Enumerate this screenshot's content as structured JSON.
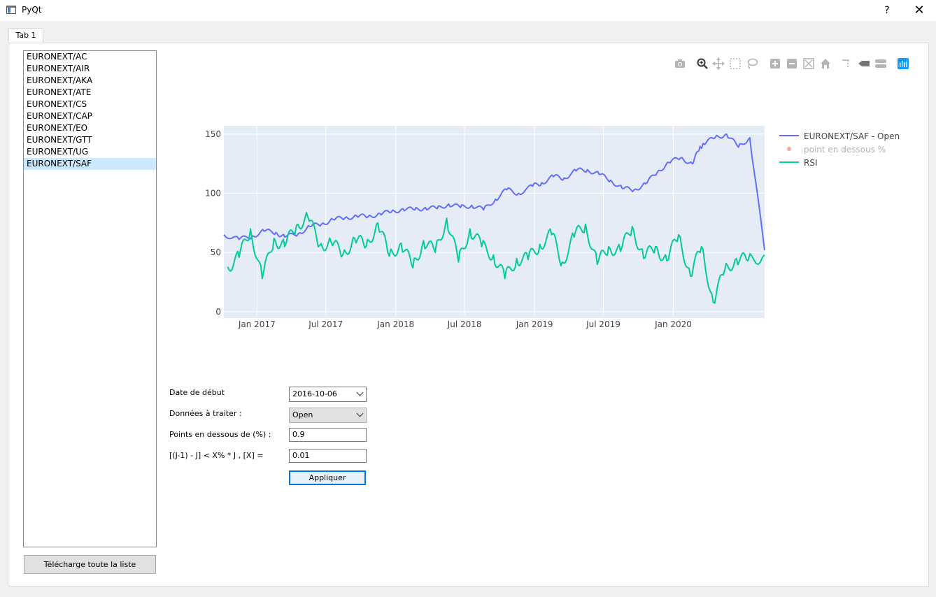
{
  "window": {
    "title": "PyQt",
    "help": "?",
    "close": "✕"
  },
  "tabs": [
    {
      "label": "Tab 1"
    }
  ],
  "sidebar": {
    "items": [
      {
        "label": "EURONEXT/AC"
      },
      {
        "label": "EURONEXT/AIR"
      },
      {
        "label": "EURONEXT/AKA"
      },
      {
        "label": "EURONEXT/ATE"
      },
      {
        "label": "EURONEXT/CS"
      },
      {
        "label": "EURONEXT/CAP"
      },
      {
        "label": "EURONEXT/EO"
      },
      {
        "label": "EURONEXT/GTT"
      },
      {
        "label": "EURONEXT/UG"
      },
      {
        "label": "EURONEXT/SAF"
      }
    ],
    "selected": "EURONEXT/SAF",
    "download_button": "Télécharge toute la liste"
  },
  "modebar": {
    "icons": [
      "camera-icon",
      "zoom-icon",
      "pan-icon",
      "box-select-icon",
      "lasso-icon",
      "zoom-in-icon",
      "zoom-out-icon",
      "autoscale-icon",
      "reset-axes-icon",
      "spike-lines-icon",
      "hover-closest-icon",
      "hover-compare-icon",
      "plotly-logo-icon"
    ]
  },
  "form": {
    "start_date": {
      "label": "Date de début",
      "value": "2016-10-06"
    },
    "data_type": {
      "label": "Données à traiter :",
      "value": "Open"
    },
    "points_below": {
      "label": "Points en dessous de (%) :",
      "value": "0.9"
    },
    "formula": {
      "label": "[(J-1) - J] < X% * J  , [X] =",
      "value": "0.01"
    },
    "apply_button": "Appliquer"
  },
  "colors": {
    "open": "#636efa",
    "points": "#ef553b",
    "rsi": "#00cc96",
    "plot_bg": "#e5ecf6",
    "selection": "#cce8ff",
    "accent": "#0078d7"
  },
  "chart_data": {
    "type": "line",
    "xlabel": "",
    "ylabel": "",
    "x_ticks": [
      "Jan 2017",
      "Jul 2017",
      "Jan 2018",
      "Jul 2018",
      "Jan 2019",
      "Jul 2019",
      "Jan 2020"
    ],
    "y_ticks": [
      0,
      50,
      100,
      150
    ],
    "ylim": [
      -3,
      157
    ],
    "xlim": [
      "2016-10-06",
      "2020-08-28"
    ],
    "grid": true,
    "legend_position": "right",
    "series": [
      {
        "name": "EURONEXT/SAF - Open",
        "type": "line",
        "x": [
          "2016-10-06",
          "2016-11-15",
          "2016-12-20",
          "2017-01-20",
          "2017-02-20",
          "2017-03-15",
          "2017-04-20",
          "2017-05-20",
          "2017-06-20",
          "2017-07-20",
          "2017-08-20",
          "2017-09-20",
          "2017-10-20",
          "2017-11-20",
          "2017-12-20",
          "2018-01-20",
          "2018-02-20",
          "2018-03-20",
          "2018-04-20",
          "2018-05-20",
          "2018-06-20",
          "2018-07-20",
          "2018-08-20",
          "2018-09-20",
          "2018-10-20",
          "2018-11-20",
          "2018-12-27",
          "2019-01-20",
          "2019-02-20",
          "2019-03-20",
          "2019-04-20",
          "2019-05-20",
          "2019-06-20",
          "2019-07-20",
          "2019-08-20",
          "2019-09-20",
          "2019-10-20",
          "2019-11-20",
          "2019-12-20",
          "2020-01-20",
          "2020-02-20",
          "2020-03-10",
          "2020-03-20",
          "2020-04-20",
          "2020-05-20",
          "2020-06-20",
          "2020-07-20",
          "2020-08-28"
        ],
        "y": [
          65,
          61,
          64,
          68,
          67,
          63,
          66,
          72,
          74,
          78,
          79,
          81,
          80,
          83,
          84,
          87,
          86,
          88,
          87,
          91,
          88,
          90,
          86,
          95,
          103,
          100,
          106,
          109,
          114,
          113,
          119,
          120,
          116,
          111,
          104,
          103,
          108,
          118,
          126,
          130,
          125,
          138,
          142,
          147,
          150,
          139,
          147,
          52
        ]
      },
      {
        "name": "point en dessous %",
        "type": "scatter",
        "x": [],
        "y": []
      },
      {
        "name": "RSI",
        "type": "line",
        "x": [
          "2016-10-16",
          "2016-11-15",
          "2016-12-15",
          "2017-01-15",
          "2017-02-15",
          "2017-03-15",
          "2017-04-15",
          "2017-05-15",
          "2017-06-15",
          "2017-07-15",
          "2017-08-15",
          "2017-09-15",
          "2017-10-15",
          "2017-11-15",
          "2017-12-15",
          "2018-01-15",
          "2018-02-15",
          "2018-03-15",
          "2018-04-15",
          "2018-05-15",
          "2018-06-15",
          "2018-07-15",
          "2018-08-15",
          "2018-09-15",
          "2018-10-15",
          "2018-11-15",
          "2018-12-15",
          "2019-01-15",
          "2019-02-15",
          "2019-03-15",
          "2019-04-15",
          "2019-05-15",
          "2019-06-15",
          "2019-07-15",
          "2019-08-15",
          "2019-09-15",
          "2019-10-15",
          "2019-11-15",
          "2019-12-15",
          "2020-01-15",
          "2020-02-15",
          "2020-03-15",
          "2020-04-15",
          "2020-05-15",
          "2020-06-15",
          "2020-07-15",
          "2020-08-28"
        ],
        "y": [
          38,
          46,
          70,
          28,
          62,
          55,
          73,
          80,
          56,
          59,
          48,
          62,
          55,
          75,
          47,
          58,
          37,
          60,
          50,
          79,
          42,
          70,
          55,
          48,
          28,
          45,
          44,
          57,
          65,
          42,
          63,
          74,
          40,
          55,
          51,
          72,
          45,
          55,
          43,
          65,
          30,
          55,
          8,
          35,
          45,
          43,
          48
        ]
      }
    ]
  }
}
